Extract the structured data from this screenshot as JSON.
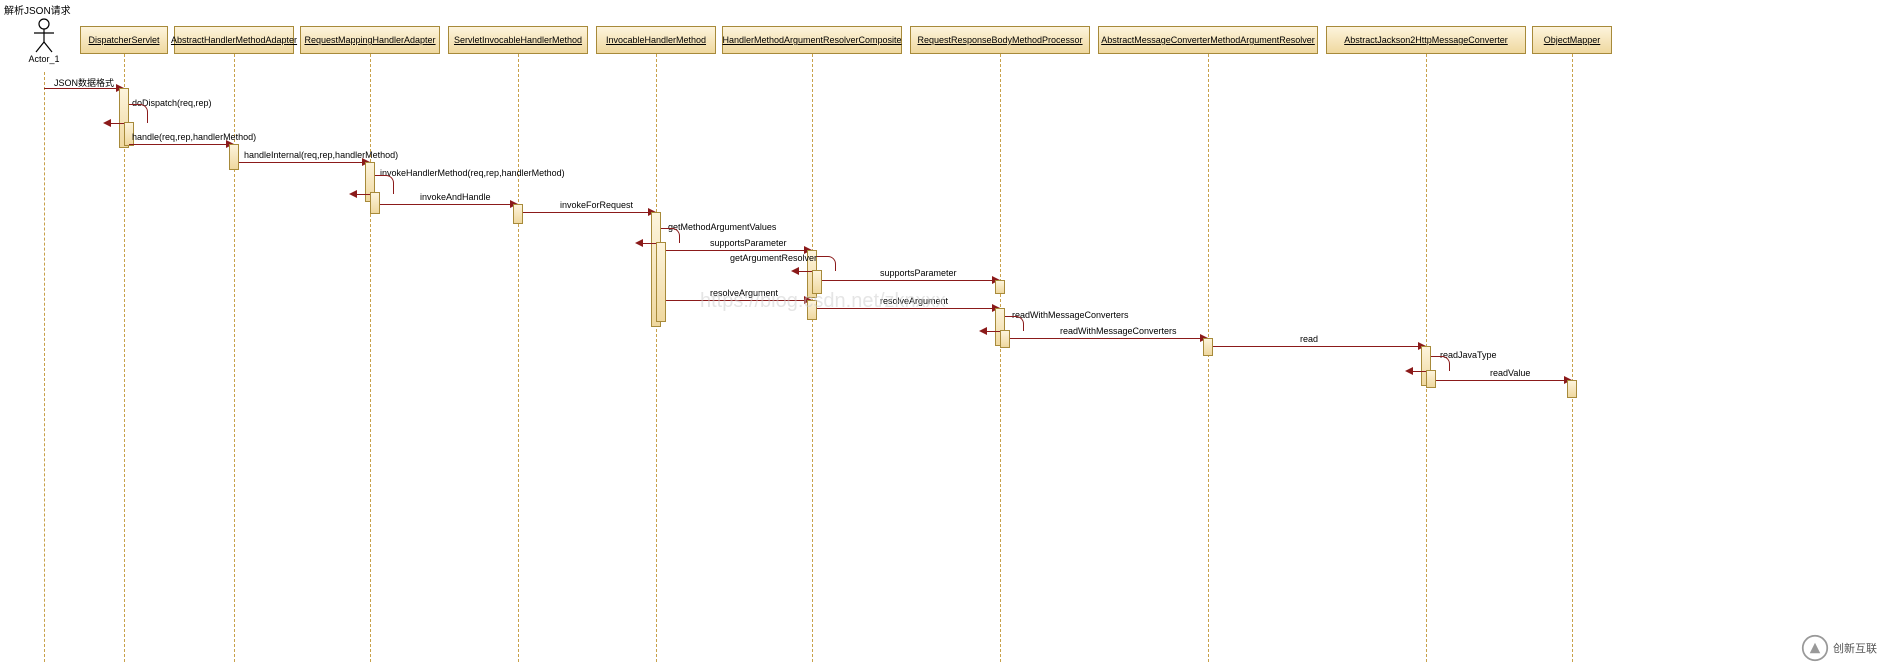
{
  "title": "解析JSON请求",
  "actor": {
    "name": "Actor_1"
  },
  "participants": [
    {
      "id": "p1",
      "label": "DispatcherServlet"
    },
    {
      "id": "p2",
      "label": "AbstractHandlerMethodAdapter"
    },
    {
      "id": "p3",
      "label": "RequestMappingHandlerAdapter"
    },
    {
      "id": "p4",
      "label": "ServletInvocableHandlerMethod"
    },
    {
      "id": "p5",
      "label": "InvocableHandlerMethod"
    },
    {
      "id": "p6",
      "label": "HandlerMethodArgumentResolverComposite"
    },
    {
      "id": "p7",
      "label": "RequestResponseBodyMethodProcessor"
    },
    {
      "id": "p8",
      "label": "AbstractMessageConverterMethodArgumentResolver"
    },
    {
      "id": "p9",
      "label": "AbstractJackson2HttpMessageConverter"
    },
    {
      "id": "p10",
      "label": "ObjectMapper"
    }
  ],
  "messages": {
    "m1": "JSON数据格式",
    "m2": "doDispatch(req,rep)",
    "m3": "handle(req,rep,handlerMethod)",
    "m4": "handleInternal(req,rep,handlerMethod)",
    "m5": "invokeHandlerMethod(req,rep,handlerMethod)",
    "m6": "invokeAndHandle",
    "m7": "invokeForRequest",
    "m8": "getMethodArgumentValues",
    "m9": "supportsParameter",
    "m10": "getArgumentResolver",
    "m11": "supportsParameter",
    "m12": "resolveArgument",
    "m13": "resolveArgument",
    "m14": "readWithMessageConverters",
    "m15": "readWithMessageConverters",
    "m16": "read",
    "m17": "readJavaType",
    "m18": "readValue"
  },
  "watermark": "https://blog.csdn.net/zknxxx",
  "logo": "创新互联"
}
